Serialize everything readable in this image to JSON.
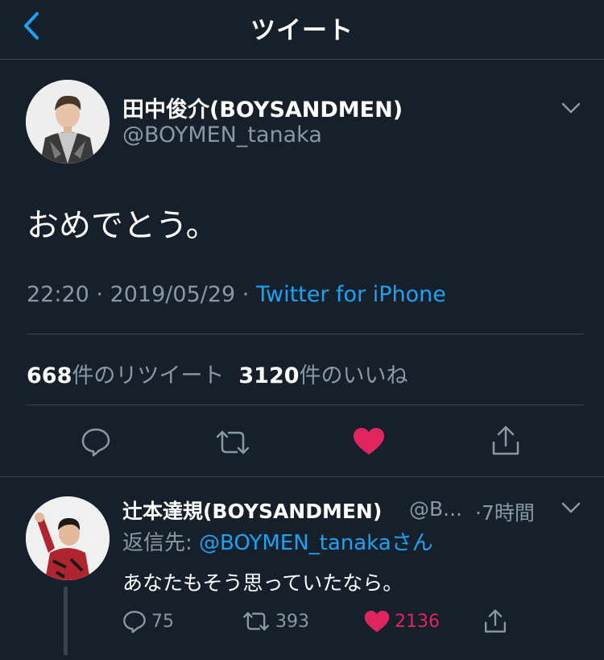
{
  "header": {
    "title": "ツイート"
  },
  "tweet": {
    "author_name": "田中俊介(BOYSANDMEN)",
    "author_handle": "@BOYMEN_tanaka",
    "text": "おめでとう。",
    "time": "22:20",
    "date": "2019/05/29",
    "source": "Twitter for iPhone",
    "retweet_count": "668",
    "retweet_label": "件のリツイート",
    "like_count": "3120",
    "like_label": "件のいいね"
  },
  "reply": {
    "author_name": "辻本達規(BOYSANDMEN)",
    "author_handle": "@B...",
    "time_ago": "7時間",
    "reply_prefix": "返信先: ",
    "reply_mention": "@BOYMEN_tanaka",
    "reply_suffix": "さん",
    "text": "あなたもそう思っていたなら。",
    "reply_count": "75",
    "retweet_count": "393",
    "like_count": "2136"
  },
  "colors": {
    "background": "#15202b",
    "accent": "#1da1f2",
    "like": "#e0245e",
    "muted": "#8899a6",
    "divider": "#38444d"
  },
  "icons": [
    "back-chevron-icon",
    "chevron-down-icon",
    "reply-icon",
    "retweet-icon",
    "heart-icon",
    "share-icon"
  ]
}
